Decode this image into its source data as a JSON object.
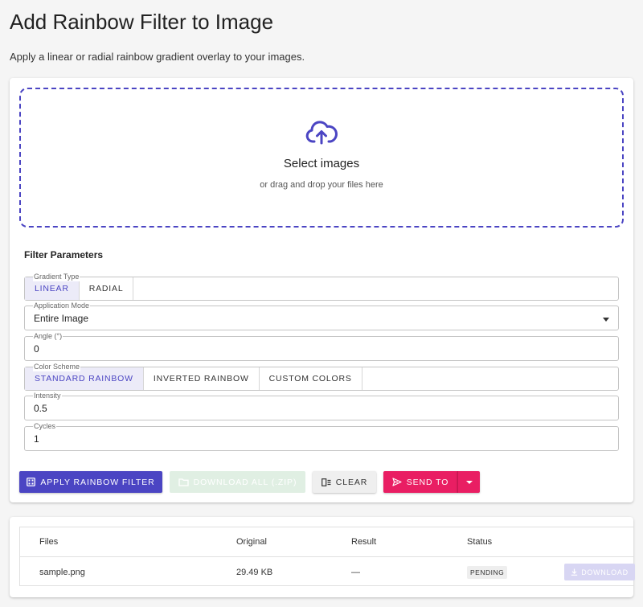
{
  "page": {
    "title": "Add Rainbow Filter to Image",
    "subtitle": "Apply a linear or radial rainbow gradient overlay to your images."
  },
  "dropzone": {
    "title": "Select images",
    "subtitle": "or drag and drop your files here",
    "icon": "cloud-upload-icon"
  },
  "params": {
    "section_title": "Filter Parameters",
    "gradient_type": {
      "label": "Gradient Type",
      "options": [
        "LINEAR",
        "RADIAL"
      ],
      "selected": "LINEAR"
    },
    "application_mode": {
      "label": "Application Mode",
      "value": "Entire Image"
    },
    "angle": {
      "label": "Angle (°)",
      "value": "0"
    },
    "color_scheme": {
      "label": "Color Scheme",
      "options": [
        "STANDARD RAINBOW",
        "INVERTED RAINBOW",
        "CUSTOM COLORS"
      ],
      "selected": "STANDARD RAINBOW"
    },
    "intensity": {
      "label": "Intensity",
      "value": "0.5"
    },
    "cycles": {
      "label": "Cycles",
      "value": "1"
    }
  },
  "actions": {
    "apply_label": "APPLY RAINBOW FILTER",
    "download_all_label": "DOWNLOAD ALL (.ZIP)",
    "clear_label": "CLEAR",
    "send_to_label": "SEND TO"
  },
  "files_table": {
    "headers": [
      "Files",
      "Original",
      "Result",
      "Status"
    ],
    "rows": [
      {
        "file": "sample.png",
        "original": "29.49 KB",
        "result": "—",
        "status": "PENDING",
        "download_label": "DOWNLOAD"
      }
    ]
  },
  "colors": {
    "primary": "#4b45c3",
    "accent": "#e91e63",
    "download_disabled": "#e0efe3"
  }
}
